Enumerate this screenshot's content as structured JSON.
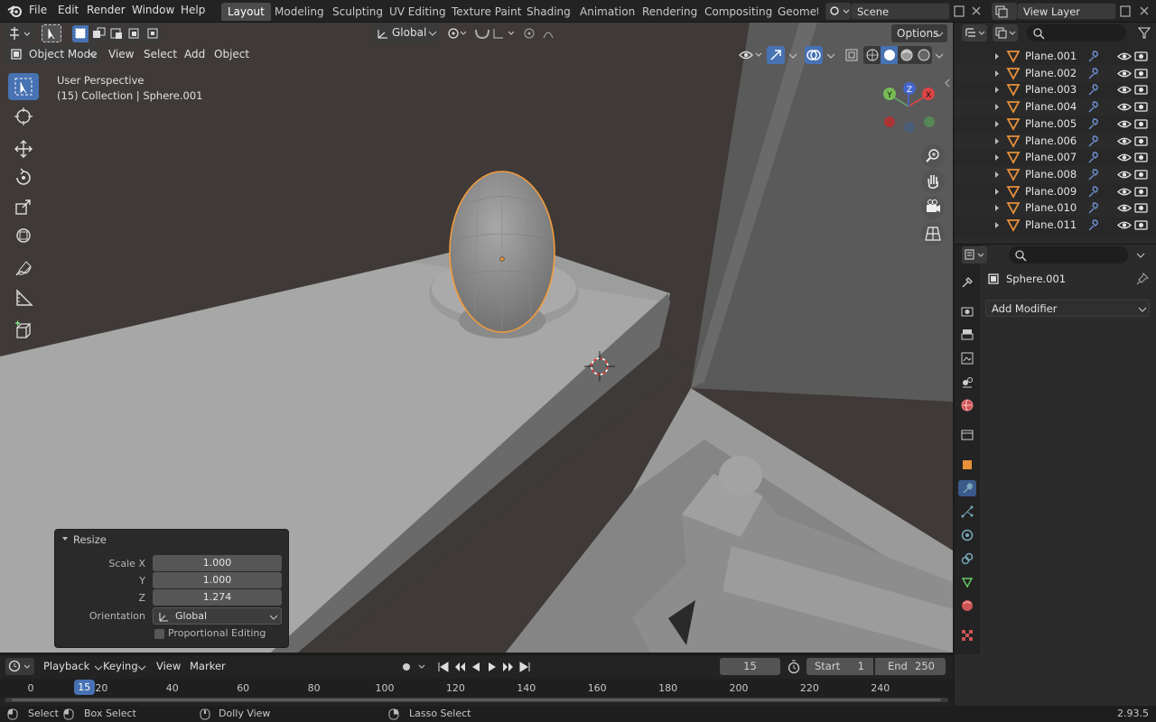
{
  "menu": [
    "File",
    "Edit",
    "Render",
    "Window",
    "Help"
  ],
  "workspaces": [
    "Layout",
    "Modeling",
    "Sculpting",
    "UV Editing",
    "Texture Paint",
    "Shading",
    "Animation",
    "Rendering",
    "Compositing",
    "Geometr"
  ],
  "active_workspace": "Layout",
  "scene": "Scene",
  "view_layer": "View Layer",
  "viewport": {
    "transform_orientation": "Global",
    "options": "Options",
    "mode": "Object Mode",
    "header_menus": [
      "View",
      "Select",
      "Add",
      "Object"
    ],
    "perspective": "User Perspective",
    "collection_info": "(15) Collection | Sphere.001",
    "gizmo_axes": [
      "X",
      "Y",
      "Z"
    ]
  },
  "resize_panel": {
    "title": "Resize",
    "scale_x_label": "Scale X",
    "scale_x": "1.000",
    "y_label": "Y",
    "scale_y": "1.000",
    "z_label": "Z",
    "scale_z": "1.274",
    "orientation_label": "Orientation",
    "orientation": "Global",
    "proportional_editing": "Proportional Editing"
  },
  "outliner": {
    "items": [
      "Plane.001",
      "Plane.002",
      "Plane.003",
      "Plane.004",
      "Plane.005",
      "Plane.006",
      "Plane.007",
      "Plane.008",
      "Plane.009",
      "Plane.010",
      "Plane.011"
    ]
  },
  "properties": {
    "object_name": "Sphere.001",
    "add_modifier": "Add Modifier"
  },
  "timeline": {
    "menus": [
      "Playback",
      "Keying",
      "View",
      "Marker"
    ],
    "current_frame": "15",
    "start_label": "Start",
    "start": "1",
    "end_label": "End",
    "end": "250",
    "ticks": [
      "0",
      "20",
      "40",
      "60",
      "80",
      "100",
      "120",
      "140",
      "160",
      "180",
      "200",
      "220",
      "240"
    ],
    "playhead": "15"
  },
  "statusbar": {
    "select": "Select",
    "box_select": "Box Select",
    "dolly_view": "Dolly View",
    "lasso_select": "Lasso Select",
    "version": "2.93.5"
  },
  "colors": {
    "accent": "#4772b3",
    "selection": "#f29b3c",
    "mesh_icon": "#e8903a"
  }
}
